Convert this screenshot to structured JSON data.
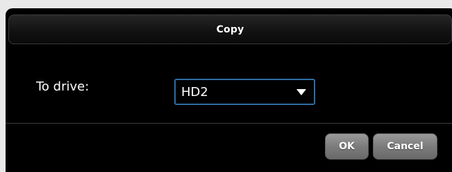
{
  "dialog": {
    "title": "Copy"
  },
  "form": {
    "drive_label": "To drive:",
    "drive_selected": "HD2"
  },
  "buttons": {
    "ok_label": "OK",
    "cancel_label": "Cancel"
  },
  "colors": {
    "background": "#000000",
    "select_border": "#2f6da4",
    "button": "#7c7c7c",
    "text": "#ffffff"
  }
}
